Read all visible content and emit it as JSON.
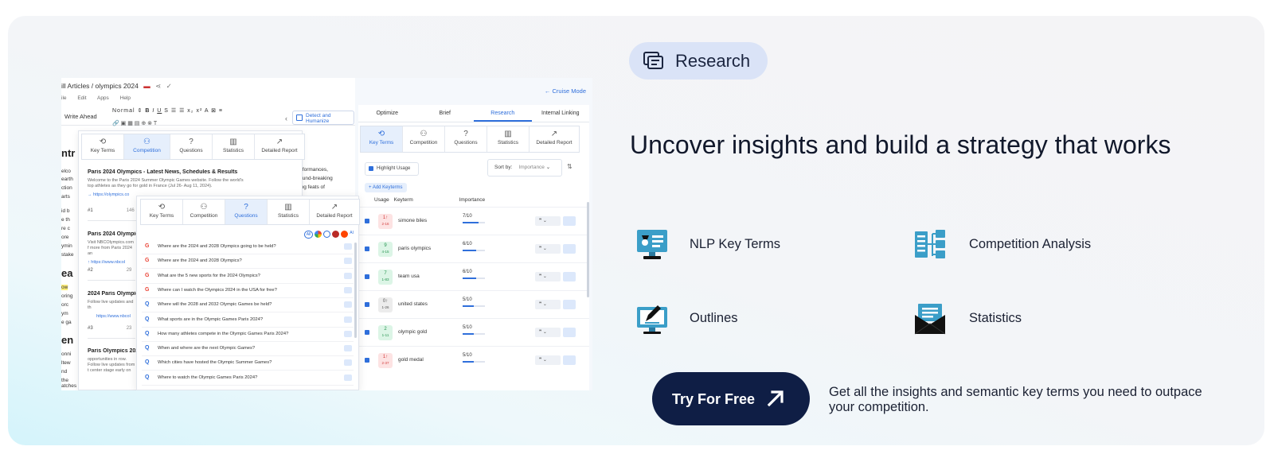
{
  "editor": {
    "breadcrumb": "ill Articles / olympics 2024",
    "menu": [
      "ile",
      "Edit",
      "Apps",
      "Help"
    ],
    "write_ahead": "Write Ahead",
    "style_select": "Normal",
    "detect_button": "Detect and Humanize",
    "text_lines": [
      "ntr",
      "elco",
      "earth",
      "ction",
      "arts",
      "id b",
      "e th",
      "re c",
      "ore",
      "ymin",
      "stake",
      "ea",
      "ow",
      "oring",
      "orc",
      "ym",
      "e ga",
      "en",
      "onni",
      "ltew",
      "nd",
      "the",
      "atches like USA's Coco Gauff",
      "erformances,",
      "round-breaking",
      "ring feats of"
    ]
  },
  "research_panel": {
    "cruise_mode": "← Cruise Mode",
    "tabs": [
      "Optimize",
      "Brief",
      "Research",
      "Internal Linking"
    ],
    "subtabs": [
      "Key Terms",
      "Competition",
      "Questions",
      "Statistics",
      "Detailed Report"
    ],
    "highlight_usage": "Highlight Usage",
    "sort_by_label": "Sort by:",
    "sort_by_value": "Importance",
    "add_keyterms": "+ Add Keyterms",
    "columns": [
      "Usage",
      "Keyterm",
      "Importance"
    ],
    "keyterms": [
      {
        "usage": "1↑",
        "range": "2-16",
        "name": "simone biles",
        "importance": "7/10",
        "color": "red",
        "fill": 0.7
      },
      {
        "usage": "9",
        "range": "4-15",
        "name": "paris olympics",
        "importance": "6/10",
        "color": "green",
        "fill": 0.6
      },
      {
        "usage": "7",
        "range": "1-83",
        "name": "team usa",
        "importance": "6/10",
        "color": "green",
        "fill": 0.6
      },
      {
        "usage": "0↑",
        "range": "1-26",
        "name": "united states",
        "importance": "5/10",
        "color": "gray",
        "fill": 0.5
      },
      {
        "usage": "2",
        "range": "1-11",
        "name": "olympic gold",
        "importance": "5/10",
        "color": "green",
        "fill": 0.5
      },
      {
        "usage": "1↑",
        "range": "2-37",
        "name": "gold medal",
        "importance": "5/10",
        "color": "red",
        "fill": 0.5
      }
    ]
  },
  "competition_panel": {
    "subtabs": [
      "Key Terms",
      "Competition",
      "Questions",
      "Statistics",
      "Detailed Report"
    ],
    "results": [
      {
        "title": "Paris 2024 Olympics - Latest News, Schedules & Results",
        "desc": "Welcome to the Paris 2024 Summer Olympic Games website. Follow the world's top athletes as they go for gold in France (Jul 26- Aug 11, 2024).",
        "link": "→  https://olympics.co",
        "rank": "#1"
      },
      {
        "title": "Paris 2024 Olympic",
        "desc": "Visit NBCOlympics.com f more from Paris 2024 an",
        "link": "↑  https://www.nbcol",
        "rank": "#2"
      },
      {
        "title": "2024 Paris Olympic",
        "desc": "Follow live updates and th",
        "link": "https://www.nbcol",
        "rank": "#3"
      },
      {
        "title": "Paris Olympics 202",
        "desc": "opportunities in row. Follow live updates from t center stage early on",
        "link": "",
        "rank": ""
      }
    ],
    "rank_extra": [
      "146",
      "29",
      "23"
    ]
  },
  "questions_panel": {
    "subtabs": [
      "Key Terms",
      "Competition",
      "Questions",
      "Statistics",
      "Detailed Report"
    ],
    "all_label": "All",
    "questions": [
      {
        "src": "G",
        "text": "Where are the 2024 and 2028 Olympics going to be held?"
      },
      {
        "src": "G",
        "text": "Where are the 2024 and 2028 Olympics?"
      },
      {
        "src": "G",
        "text": "What are the 5 new sports for the 2024 Olympics?"
      },
      {
        "src": "G",
        "text": "Where can I watch the Olympics 2024 in the USA for free?"
      },
      {
        "src": "Q",
        "text": "Where will the 2028 and 2032 Olympic Games be held?"
      },
      {
        "src": "Q",
        "text": "What sports are in the Olympic Games Paris 2024?"
      },
      {
        "src": "Q",
        "text": "How many athletes compete in the Olympic Games Paris 2024?"
      },
      {
        "src": "Q",
        "text": "When and where are the next Olympic Games?"
      },
      {
        "src": "Q",
        "text": "Which cities have hosted the Olympic Summer Games?"
      },
      {
        "src": "Q",
        "text": "Where to watch the Olympic Games Paris 2024?"
      }
    ]
  },
  "content": {
    "badge": "Research",
    "headline": "Uncover insights and build a strategy that works",
    "features": [
      "NLP Key Terms",
      "Competition Analysis",
      "Outlines",
      "Statistics"
    ],
    "cta_label": "Try For Free",
    "cta_note": "Get all the insights and semantic key terms you need to outpace your competition."
  },
  "colors": {
    "accent": "#2f6fdb",
    "cta_bg": "#0f1e45",
    "badge_bg": "#dae3f7",
    "icon_teal": "#3b9ec8"
  }
}
